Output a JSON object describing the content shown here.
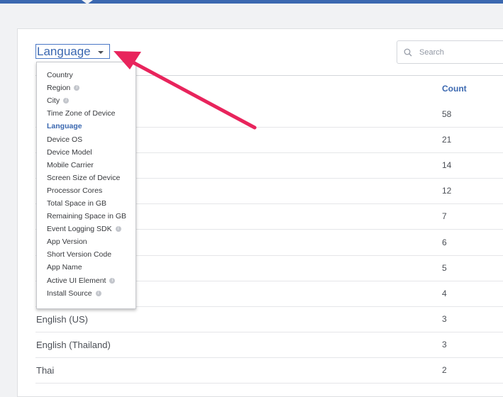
{
  "dimension_selector": {
    "label": "Language"
  },
  "search": {
    "placeholder": "Search"
  },
  "table": {
    "count_header": "Count",
    "rows": [
      {
        "name": "",
        "count": "58"
      },
      {
        "name": "",
        "count": "21"
      },
      {
        "name": "",
        "count": "14"
      },
      {
        "name": "",
        "count": "12"
      },
      {
        "name": "",
        "count": "7"
      },
      {
        "name": "",
        "count": "6"
      },
      {
        "name": "",
        "count": "5"
      },
      {
        "name": "",
        "count": "4"
      },
      {
        "name": "English (US)",
        "count": "3"
      },
      {
        "name": "English (Thailand)",
        "count": "3"
      },
      {
        "name": "Thai",
        "count": "2"
      }
    ]
  },
  "dropdown": {
    "items": [
      {
        "label": "Country",
        "info": false,
        "selected": false
      },
      {
        "label": "Region",
        "info": true,
        "selected": false
      },
      {
        "label": "City",
        "info": true,
        "selected": false
      },
      {
        "label": "Time Zone of Device",
        "info": false,
        "selected": false
      },
      {
        "label": "Language",
        "info": false,
        "selected": true
      },
      {
        "label": "Device OS",
        "info": false,
        "selected": false
      },
      {
        "label": "Device Model",
        "info": false,
        "selected": false
      },
      {
        "label": "Mobile Carrier",
        "info": false,
        "selected": false
      },
      {
        "label": "Screen Size of Device",
        "info": false,
        "selected": false
      },
      {
        "label": "Processor Cores",
        "info": false,
        "selected": false
      },
      {
        "label": "Total Space in GB",
        "info": false,
        "selected": false
      },
      {
        "label": "Remaining Space in GB",
        "info": false,
        "selected": false
      },
      {
        "label": "Event Logging SDK",
        "info": true,
        "selected": false
      },
      {
        "label": "App Version",
        "info": false,
        "selected": false
      },
      {
        "label": "Short Version Code",
        "info": false,
        "selected": false
      },
      {
        "label": "App Name",
        "info": false,
        "selected": false
      },
      {
        "label": "Active UI Element",
        "info": true,
        "selected": false
      },
      {
        "label": "Install Source",
        "info": true,
        "selected": false
      }
    ]
  },
  "annotation": {
    "arrow_color": "#e8245c"
  },
  "colors": {
    "accent": "#3b68b0",
    "topbar": "#3b68b0"
  }
}
